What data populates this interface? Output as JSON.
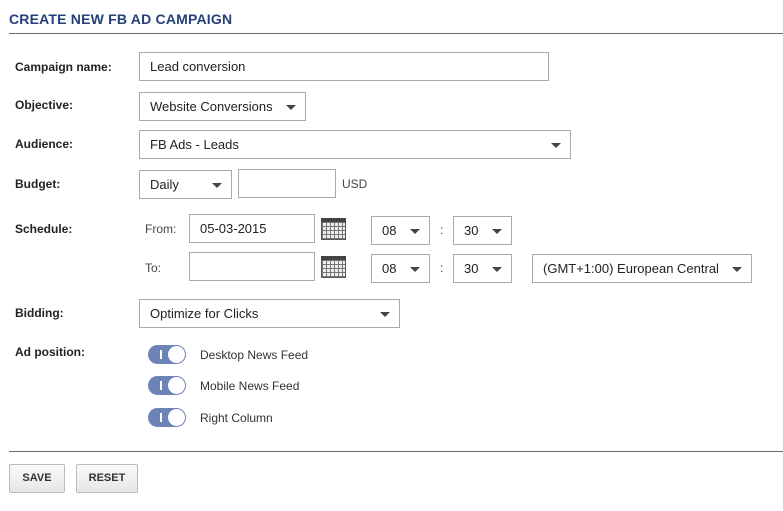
{
  "title": "CREATE NEW FB AD CAMPAIGN",
  "labels": {
    "campaign_name": "Campaign name:",
    "objective": "Objective:",
    "audience": "Audience:",
    "budget": "Budget:",
    "schedule": "Schedule:",
    "bidding": "Bidding:",
    "ad_position": "Ad position:"
  },
  "campaign_name": {
    "value": "Lead conversion"
  },
  "objective": {
    "selected": "Website Conversions"
  },
  "audience": {
    "selected": "FB Ads - Leads"
  },
  "budget": {
    "period": "Daily",
    "amount": "",
    "currency": "USD"
  },
  "schedule": {
    "from_label": "From:",
    "to_label": "To:",
    "from_date": "05-03-2015",
    "to_date": "",
    "from_hour": "08",
    "from_minute": "30",
    "to_hour": "08",
    "to_minute": "30",
    "time_sep": ":",
    "timezone": "(GMT+1:00) European Central"
  },
  "bidding": {
    "selected": "Optimize for Clicks"
  },
  "ad_positions": [
    {
      "label": "Desktop News Feed",
      "enabled": true
    },
    {
      "label": "Mobile News Feed",
      "enabled": true
    },
    {
      "label": "Right Column",
      "enabled": true
    }
  ],
  "buttons": {
    "save": "SAVE",
    "reset": "RESET"
  },
  "colors": {
    "title": "#253f7a",
    "toggle_on": "#6b83b5"
  },
  "icons": {
    "calendar": "calendar-icon",
    "dropdown": "chevron-down-icon"
  }
}
